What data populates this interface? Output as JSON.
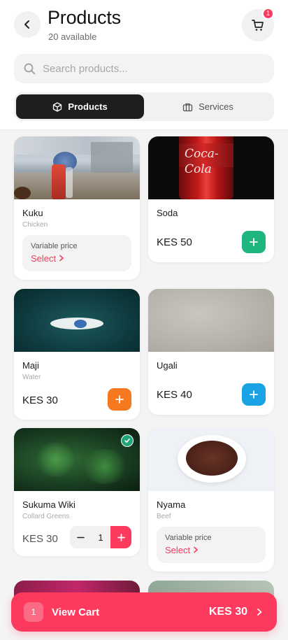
{
  "header": {
    "title": "Products",
    "subtitle": "20 available",
    "cart_count": "1"
  },
  "search": {
    "placeholder": "Search products..."
  },
  "tabs": [
    {
      "label": "Products",
      "active": true
    },
    {
      "label": "Services",
      "active": false
    }
  ],
  "products": [
    {
      "name": "Kuku",
      "category": "Chicken",
      "variable_label": "Variable price",
      "select_label": "Select"
    },
    {
      "name": "Soda",
      "price": "KES 50",
      "accent": "#1db67f"
    },
    {
      "name": "Maji",
      "category": "Water",
      "price": "KES 30",
      "accent": "#f7791f"
    },
    {
      "name": "Ugali",
      "price": "KES 40",
      "accent": "#1aa2e6"
    },
    {
      "name": "Sukuma Wiki",
      "category": "Collard Greens",
      "price": "KES 30",
      "quantity": "1",
      "selected": true
    },
    {
      "name": "Nyama",
      "category": "Beef",
      "variable_label": "Variable price",
      "select_label": "Select"
    }
  ],
  "cart_bar": {
    "count": "1",
    "label": "View Cart",
    "total": "KES 30"
  },
  "colors": {
    "brand": "#fb3a5e",
    "dark": "#1e1e1e"
  }
}
